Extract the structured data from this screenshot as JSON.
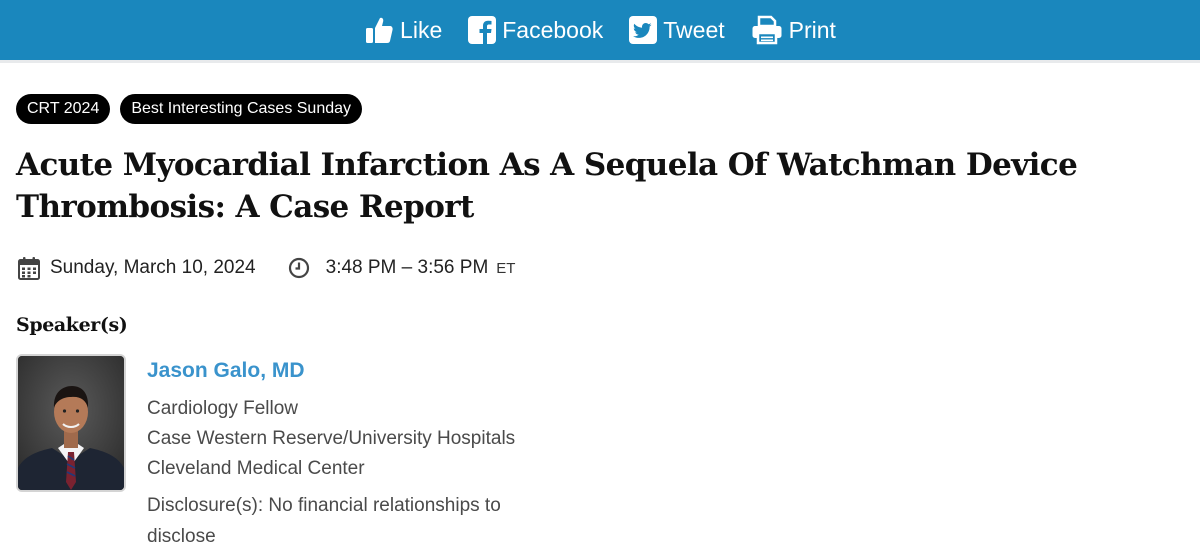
{
  "share_bar": {
    "background": "#1a87bd",
    "items": [
      {
        "label": "Like",
        "icon": "thumbs-up-icon"
      },
      {
        "label": "Facebook",
        "icon": "facebook-icon"
      },
      {
        "label": "Tweet",
        "icon": "twitter-icon"
      },
      {
        "label": "Print",
        "icon": "printer-icon"
      }
    ]
  },
  "tags": [
    "CRT 2024",
    "Best Interesting Cases Sunday"
  ],
  "title": "Acute Myocardial Infarction As A Sequela Of Watchman Device Thrombosis: A Case Report",
  "session": {
    "date": "Sunday, March 10, 2024",
    "date_icon": "calendar-icon",
    "time": "3:48 PM – 3:56 PM",
    "timezone": "ET",
    "time_icon": "clock-icon"
  },
  "speakers": {
    "heading": "Speaker(s)",
    "list": [
      {
        "name": "Jason Galo, MD",
        "name_color": "#3a93cc",
        "title": "Cardiology Fellow",
        "org_line1": "Case Western Reserve/University Hospitals",
        "org_line2": "Cleveland Medical Center",
        "disclosure": "Disclosure(s): No financial relationships to disclose"
      }
    ]
  }
}
